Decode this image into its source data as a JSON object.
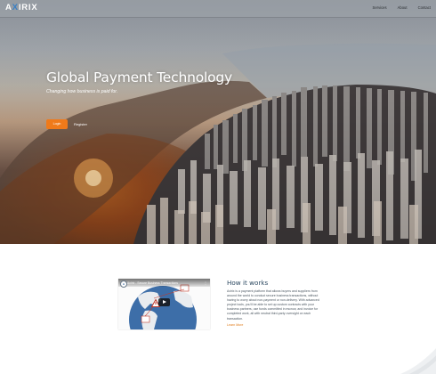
{
  "nav": {
    "logo": {
      "prefix": "A",
      "accent": "X",
      "suffix": "IRIX"
    },
    "links": [
      "Services",
      "About",
      "Contact"
    ]
  },
  "hero": {
    "title": "Global Payment Technology",
    "subtitle": "Changing how business is paid for.",
    "primary_button": "Login",
    "secondary_button": "Register"
  },
  "video": {
    "avatar_letter": "A",
    "title": "Axirix - Secure Business Transactions",
    "menu": "⋮",
    "icons": [
      "play-icon",
      "globe-icon",
      "warning-icon"
    ]
  },
  "how": {
    "title": "How it works",
    "body": "Axirix is a payment platform that allows buyers and suppliers from around the world to conduct secure business transactions, without having to worry about non-payment or non-delivery. With advanced project tools, you'll be able to set up custom contracts with your business partners, use funds committed in escrow, and invoice for completed work, all with neutral third-party oversight on each transaction.",
    "link": "Learn More"
  },
  "colors": {
    "accent_orange": "#f07a1a",
    "logo_blue": "#3a7fc4",
    "heading_navy": "#2e4a62"
  }
}
